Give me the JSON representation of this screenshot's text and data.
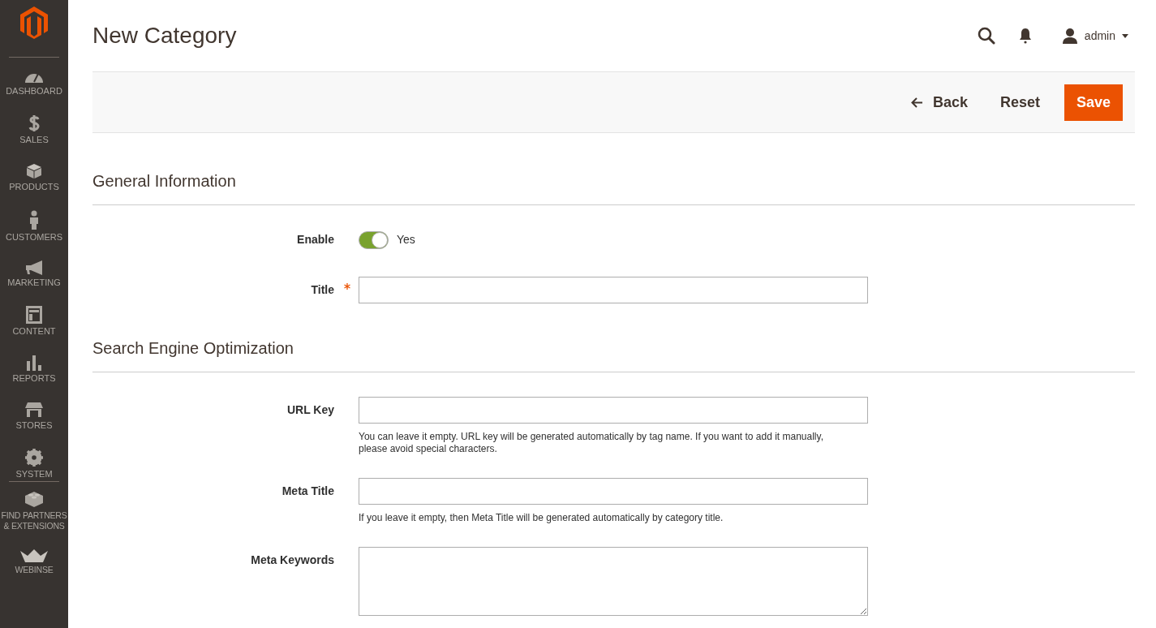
{
  "sidebar": {
    "menu_items": [
      {
        "label": "DASHBOARD"
      },
      {
        "label": "SALES"
      },
      {
        "label": "PRODUCTS"
      },
      {
        "label": "CUSTOMERS"
      },
      {
        "label": "MARKETING"
      },
      {
        "label": "CONTENT"
      },
      {
        "label": "REPORTS"
      },
      {
        "label": "STORES"
      },
      {
        "label": "SYSTEM"
      }
    ],
    "extra_items": [
      {
        "label": "FIND PARTNERS & EXTENSIONS"
      },
      {
        "label": "WEBINSE"
      }
    ]
  },
  "header": {
    "title": "New Category",
    "user": "admin"
  },
  "actions": {
    "back": "Back",
    "reset": "Reset",
    "save": "Save"
  },
  "sections": [
    {
      "title": "General Information",
      "fields": [
        {
          "kind": "toggle",
          "label": "Enable",
          "on": true,
          "value_label": "Yes"
        },
        {
          "kind": "text",
          "label": "Title",
          "required": true
        }
      ]
    },
    {
      "title": "Search Engine Optimization",
      "fields": [
        {
          "kind": "text",
          "label": "URL Key",
          "required": false,
          "note": "You can leave it empty. URL key will be generated automatically by tag name. If you want to add it manually, please avoid special characters."
        },
        {
          "kind": "text",
          "label": "Meta Title",
          "required": false,
          "note": "If you leave it empty, then Meta Title will be generated automatically by category title."
        },
        {
          "kind": "textarea",
          "label": "Meta Keywords",
          "required": false
        }
      ]
    }
  ]
}
